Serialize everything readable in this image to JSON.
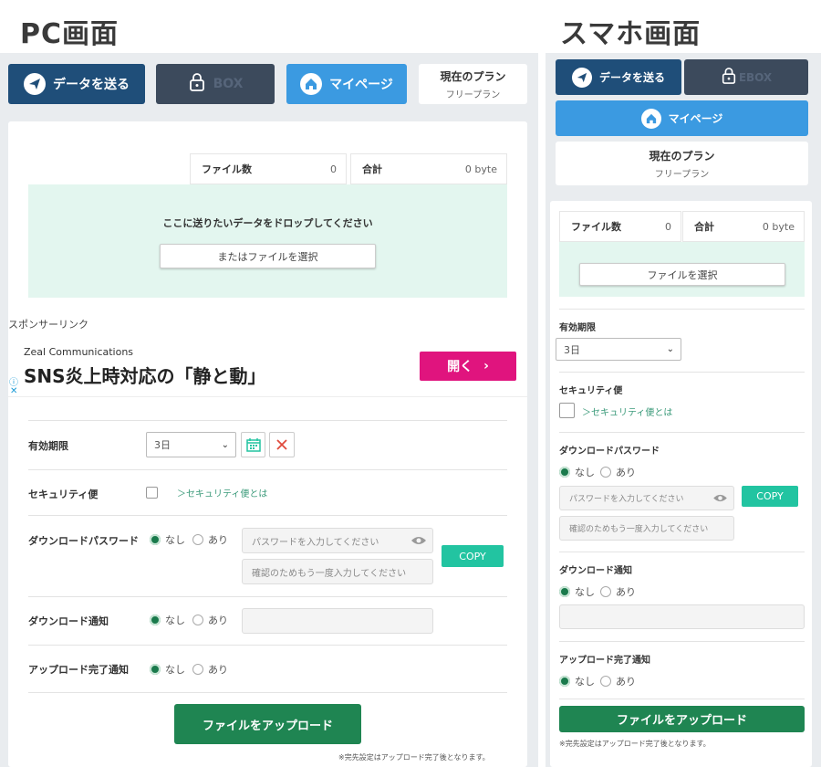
{
  "pc": {
    "heading": "PC画面",
    "nav": {
      "send": "データを送る",
      "box": "BOX",
      "mypage": "マイページ",
      "plan_title": "現在のプラン",
      "plan_name": "フリープラン"
    },
    "stats": {
      "file_count_label": "ファイル数",
      "file_count_value": "0",
      "total_label": "合計",
      "total_value": "0 byte"
    },
    "drop": {
      "message": "ここに送りたいデータをドロップしてください",
      "select_button": "またはファイルを選択"
    },
    "ad": {
      "sponsor_label": "スポンサーリンク",
      "advertiser": "Zeal Communications",
      "headline": "SNS炎上時対応の「静と動」",
      "open_button": "開く",
      "info_icon": "ⓘ",
      "close_icon": "✕"
    },
    "form": {
      "expiry_label": "有効期限",
      "expiry_value": "3日",
      "security_label": "セキュリティ便",
      "security_link": "＞セキュリティ便とは",
      "password_label": "ダウンロードパスワード",
      "option_none": "なし",
      "option_yes": "あり",
      "password_placeholder": "パスワードを入力してください",
      "password_confirm_placeholder": "確認のためもう一度入力してください",
      "copy_button": "COPY",
      "download_notify_label": "ダウンロード通知",
      "upload_notify_label": "アップロード完了通知",
      "upload_button": "ファイルをアップロード",
      "note": "※完先設定はアップロード完了後となります。"
    }
  },
  "sp": {
    "heading": "スマホ画面",
    "nav": {
      "send": "データを送る",
      "box": "EBOX",
      "mypage": "マイページ",
      "plan_title": "現在のプラン",
      "plan_name": "フリープラン"
    },
    "stats": {
      "file_count_label": "ファイル数",
      "file_count_value": "0",
      "total_label": "合計",
      "total_value": "0 byte"
    },
    "drop": {
      "select_button": "ファイルを選択"
    },
    "form": {
      "expiry_label": "有効期限",
      "expiry_value": "3日",
      "security_label": "セキュリティ便",
      "security_link": "＞セキュリティ便とは",
      "password_label": "ダウンロードパスワード",
      "option_none": "なし",
      "option_yes": "あり",
      "password_placeholder": "パスワードを入力してください",
      "password_confirm_placeholder": "確認のためもう一度入力してください",
      "copy_button": "COPY",
      "download_notify_label": "ダウンロード通知",
      "upload_notify_label": "アップロード完了通知",
      "upload_button": "ファイルをアップロード",
      "note": "※完先設定はアップロード完了後となります。"
    }
  },
  "colors": {
    "navy": "#1f4e79",
    "slate": "#3c4a5c",
    "sky": "#3b9ae1",
    "green": "#1f8552",
    "mint": "#e3f6ef",
    "teal": "#22c4a1",
    "pink": "#e0147e"
  }
}
